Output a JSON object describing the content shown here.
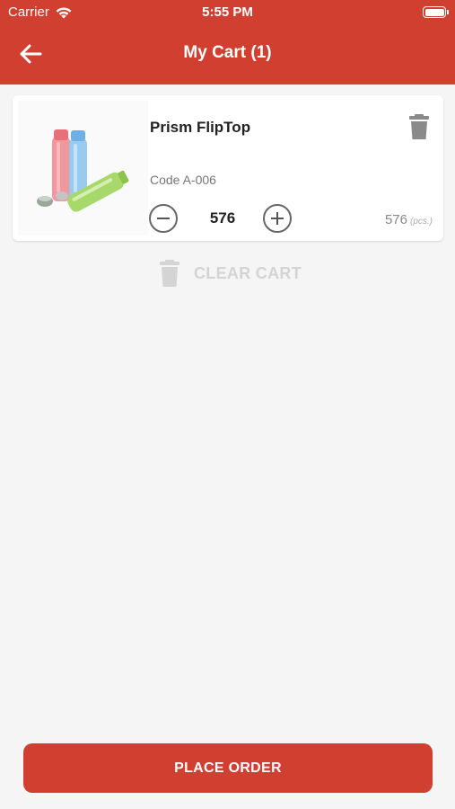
{
  "status_bar": {
    "carrier": "Carrier",
    "time": "5:55 PM",
    "wifi_icon": "wifi-icon",
    "battery_icon": "battery-icon",
    "battery_level": 1.0
  },
  "header": {
    "title": "My Cart (1)",
    "back_icon": "arrow-left-icon",
    "background_color": "#d13f31"
  },
  "cart": {
    "items": [
      {
        "name": "Prism FlipTop",
        "code": "Code A-006",
        "quantity": "576",
        "total_quantity": "576",
        "unit": "(pcs.)",
        "image_icon": "product-image",
        "delete_icon": "trash-icon",
        "decrement_icon": "minus-circle-icon",
        "increment_icon": "plus-circle-icon"
      }
    ],
    "clear_label": "CLEAR CART",
    "clear_icon": "trash-icon"
  },
  "footer": {
    "place_order_label": "PLACE ORDER",
    "accent_color": "#d13f31"
  }
}
